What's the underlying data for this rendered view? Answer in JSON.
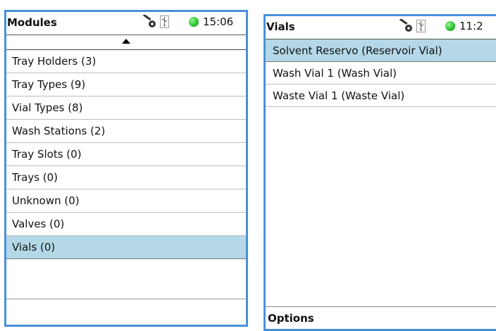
{
  "left": {
    "title": "Modules",
    "time": "15:06",
    "items": [
      {
        "label": "Tray Holders (3)"
      },
      {
        "label": "Tray Types (9)"
      },
      {
        "label": "Vial Types (8)"
      },
      {
        "label": "Wash Stations (2)"
      },
      {
        "label": "Tray Slots (0)"
      },
      {
        "label": "Trays (0)"
      },
      {
        "label": "Unknown (0)"
      },
      {
        "label": "Valves (0)"
      },
      {
        "label": "Vials (0)"
      }
    ],
    "selected_index": 8
  },
  "right": {
    "title": "Vials",
    "time": "11:2",
    "items": [
      {
        "label": "Solvent Reservo (Reservoir Vial)"
      },
      {
        "label": "Wash Vial 1 (Wash Vial)"
      },
      {
        "label": "Waste Vial 1 (Waste Vial)"
      }
    ],
    "selected_index": 0,
    "options_label": "Options"
  },
  "icons": {
    "key": "key-icon",
    "usb": "usb-icon",
    "status": "green-status-led"
  },
  "colors": {
    "frame": "#4a90d9",
    "selection": "#b4d8e8",
    "led": "#19b519"
  }
}
